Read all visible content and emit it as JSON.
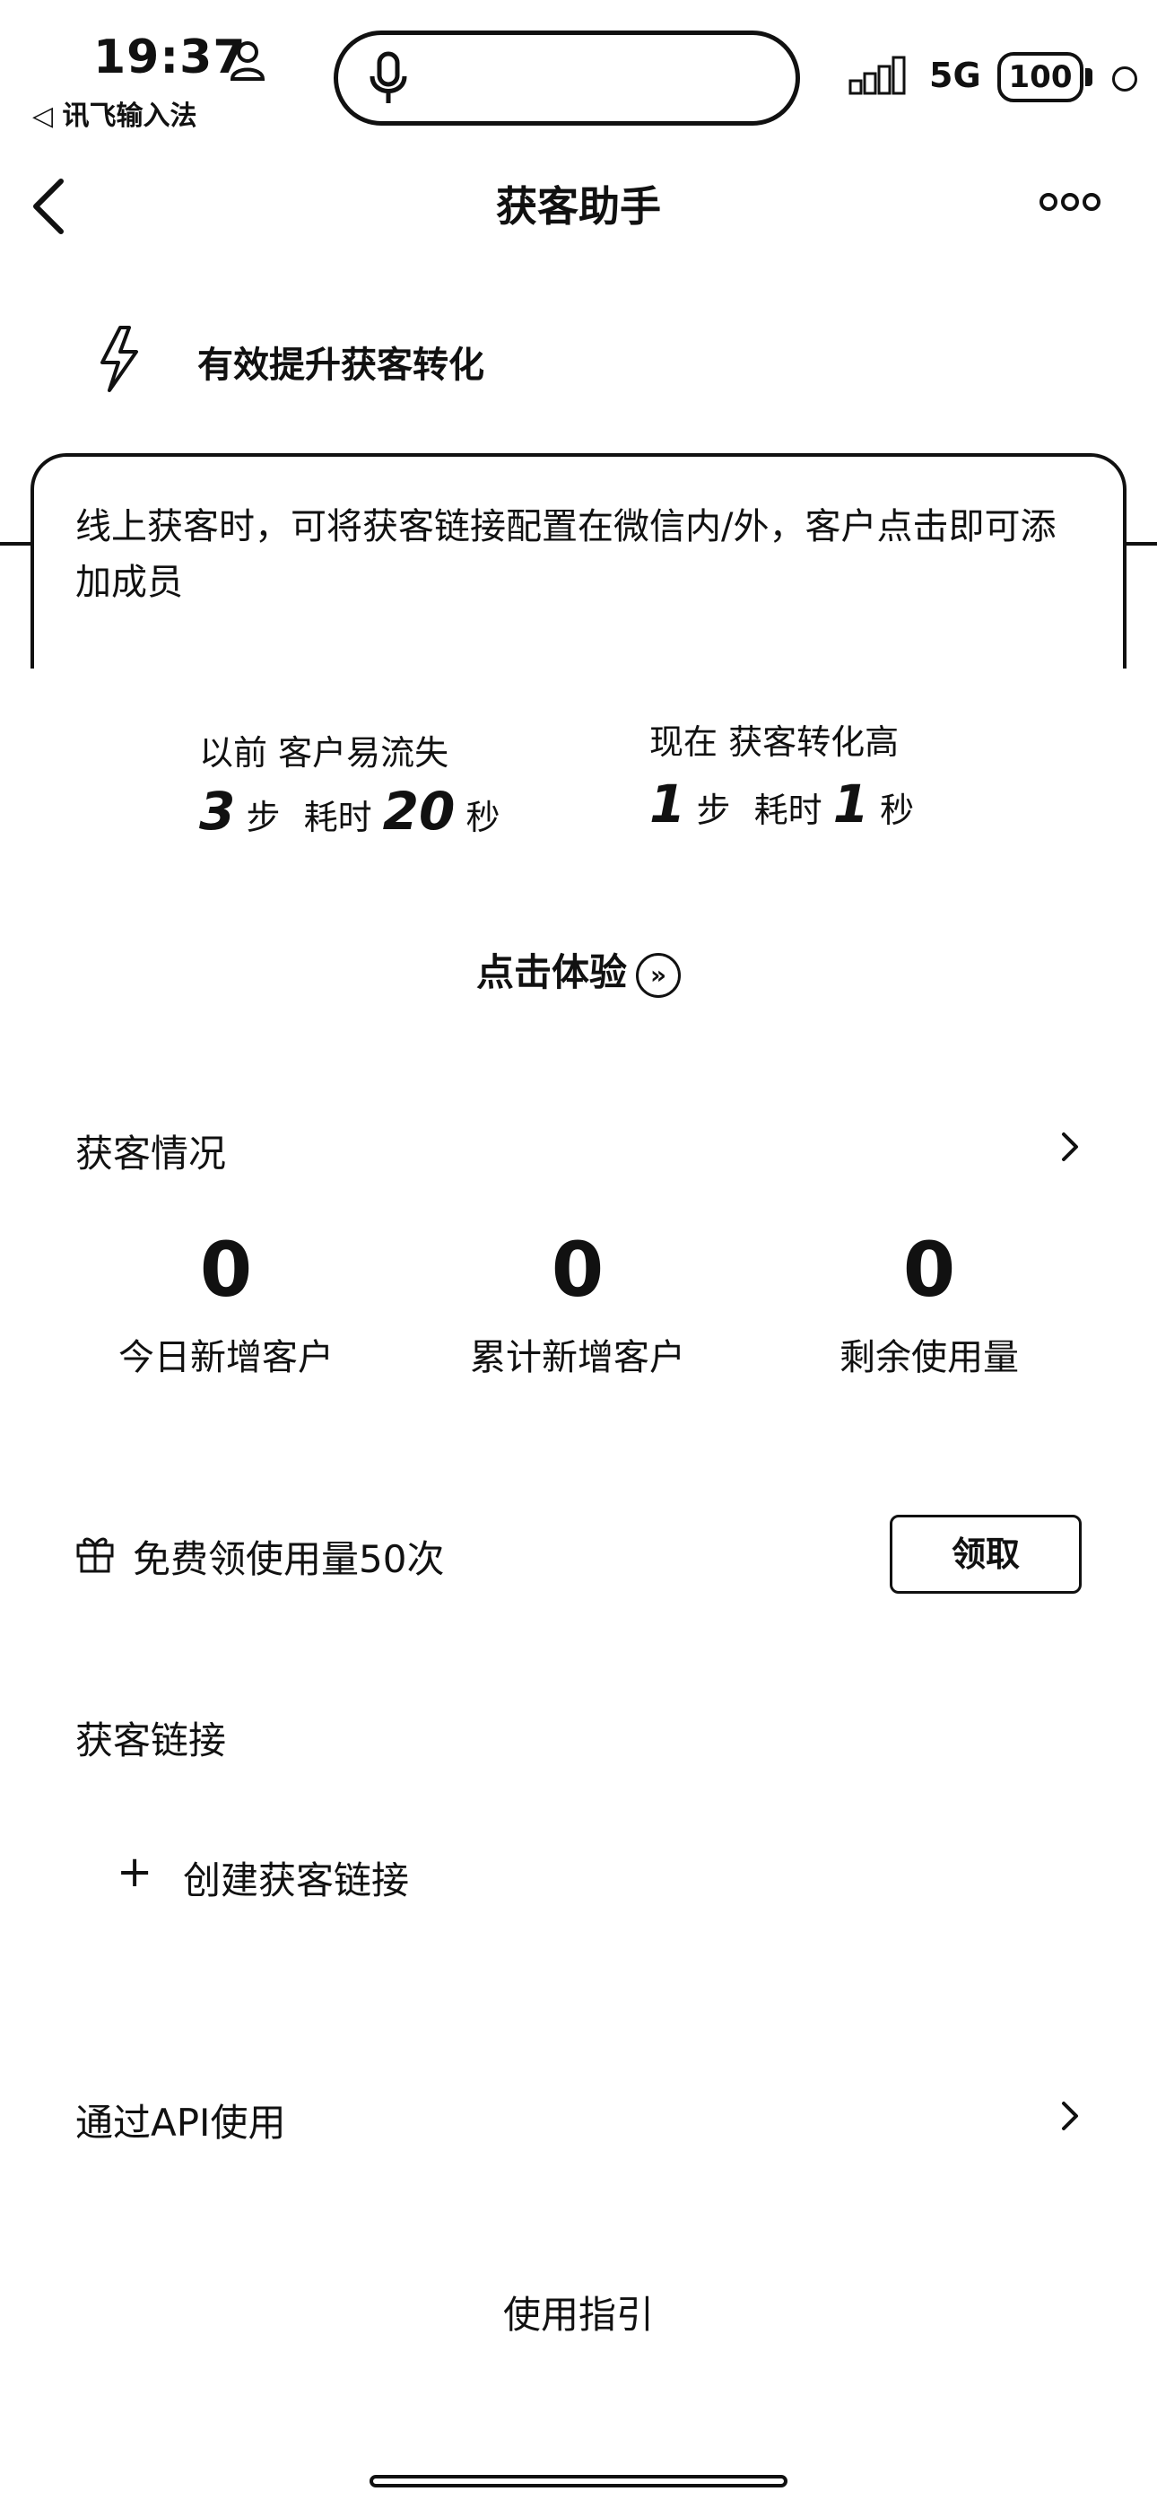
{
  "status_bar": {
    "time": "19:37",
    "source_app": "◁ 讯飞输入法",
    "network": "5G",
    "battery": "100"
  },
  "nav": {
    "back_icon": "chevron-left-icon",
    "title": "获客助手",
    "more_icon": "more-dots-icon"
  },
  "hero": {
    "tagline": "有效提升获客转化",
    "description": "线上获客时，可将获客链接配置在微信内/外，客户点击即可添加成员",
    "before": {
      "label": "以前 客户易流失",
      "steps_num": "3",
      "steps_unit": "步",
      "time_prefix": "耗时",
      "time_num": "20",
      "time_unit": "秒"
    },
    "after": {
      "label": "现在 获客转化高",
      "steps_num": "1",
      "steps_unit": "步",
      "time_prefix": "耗时",
      "time_num": "1",
      "time_unit": "秒"
    },
    "try_label": "点击体验"
  },
  "stats": {
    "title": "获客情况",
    "items": [
      {
        "value": "0",
        "label": "今日新增客户"
      },
      {
        "value": "0",
        "label": "累计新增客户"
      },
      {
        "value": "0",
        "label": "剩余使用量"
      }
    ]
  },
  "promo": {
    "text": "免费领使用量50次",
    "button": "领取"
  },
  "links": {
    "title": "获客链接",
    "create_label": "创建获客链接"
  },
  "api": {
    "label": "通过API使用"
  },
  "guide": {
    "label": "使用指引"
  }
}
